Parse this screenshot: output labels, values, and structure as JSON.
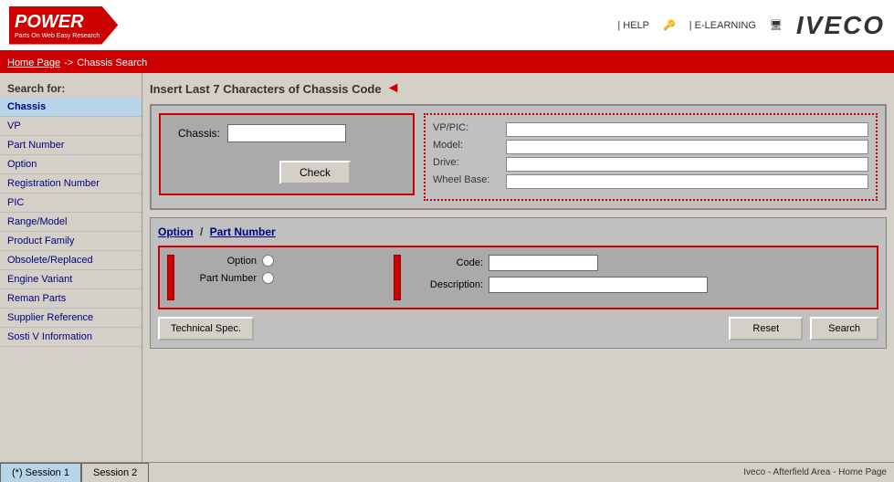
{
  "header": {
    "title": "POWER",
    "subtitle": "Parts On Web Easy Research",
    "help_link": "| HELP",
    "elearning_link": "| E-LEARNING",
    "brand": "IVECO"
  },
  "navbar": {
    "breadcrumb_home": "Home Page",
    "breadcrumb_arrow": "->",
    "breadcrumb_current": "Chassis Search"
  },
  "sidebar": {
    "title": "Search for:",
    "items": [
      {
        "id": "chassis",
        "label": "Chassis",
        "active": true
      },
      {
        "id": "vp",
        "label": "VP",
        "active": false
      },
      {
        "id": "part-number",
        "label": "Part Number",
        "active": false
      },
      {
        "id": "option",
        "label": "Option",
        "active": false
      },
      {
        "id": "registration-number",
        "label": "Registration Number",
        "active": false
      },
      {
        "id": "pic",
        "label": "PIC",
        "active": false
      },
      {
        "id": "range-model",
        "label": "Range/Model",
        "active": false
      },
      {
        "id": "product-family",
        "label": "Product Family",
        "active": false
      },
      {
        "id": "obsolete-replaced",
        "label": "Obsolete/Replaced",
        "active": false
      },
      {
        "id": "engine-variant",
        "label": "Engine Variant",
        "active": false
      },
      {
        "id": "reman-parts",
        "label": "Reman Parts",
        "active": false
      },
      {
        "id": "supplier-reference",
        "label": "Supplier Reference",
        "active": false
      },
      {
        "id": "sosti-v-info",
        "label": "Sosti V Information",
        "active": false
      }
    ]
  },
  "content": {
    "section_title": "Insert Last 7 Characters of Chassis Code",
    "chassis_label": "Chassis:",
    "chassis_placeholder": "",
    "check_button": "Check",
    "info": {
      "vp_pic_label": "VP/PIC:",
      "model_label": "Model:",
      "drive_label": "Drive:",
      "wheel_base_label": "Wheel Base:"
    },
    "option_section": {
      "option_link": "Option",
      "divider": "/",
      "part_number_link": "Part Number",
      "option_radio_label": "Option",
      "part_number_radio_label": "Part Number",
      "code_label": "Code:",
      "description_label": "Description:",
      "tech_spec_button": "Technical Spec.",
      "reset_button": "Reset",
      "search_button": "Search"
    }
  },
  "statusbar": {
    "session1_label": "(*) Session 1",
    "session2_label": "Session 2",
    "status_text": "Iveco - Afterfield Area - Home Page"
  }
}
